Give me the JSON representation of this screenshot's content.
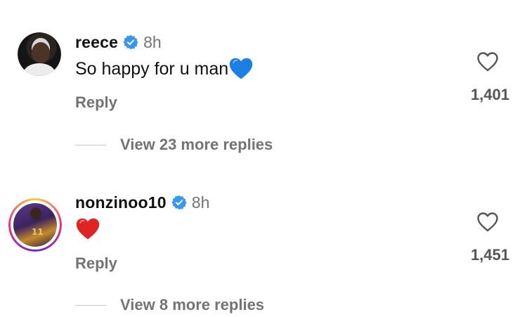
{
  "comments": [
    {
      "username": "reece",
      "verified": true,
      "time": "8h",
      "text": "So happy for u man",
      "emoji": "blue-heart",
      "reply_label": "Reply",
      "likes": "1,401",
      "view_replies": "View 23 more replies"
    },
    {
      "username": "nonzinoo10",
      "verified": true,
      "time": "8h",
      "text": "",
      "emoji": "red-heart",
      "reply_label": "Reply",
      "likes": "1,451",
      "view_replies": "View 8 more replies",
      "avatar_jersey_number": "11"
    }
  ],
  "colors": {
    "secondary_text": "#737373",
    "verified_blue": "#3897f0",
    "blue_heart": "#1d7fe6",
    "red_heart": "#e02424"
  }
}
